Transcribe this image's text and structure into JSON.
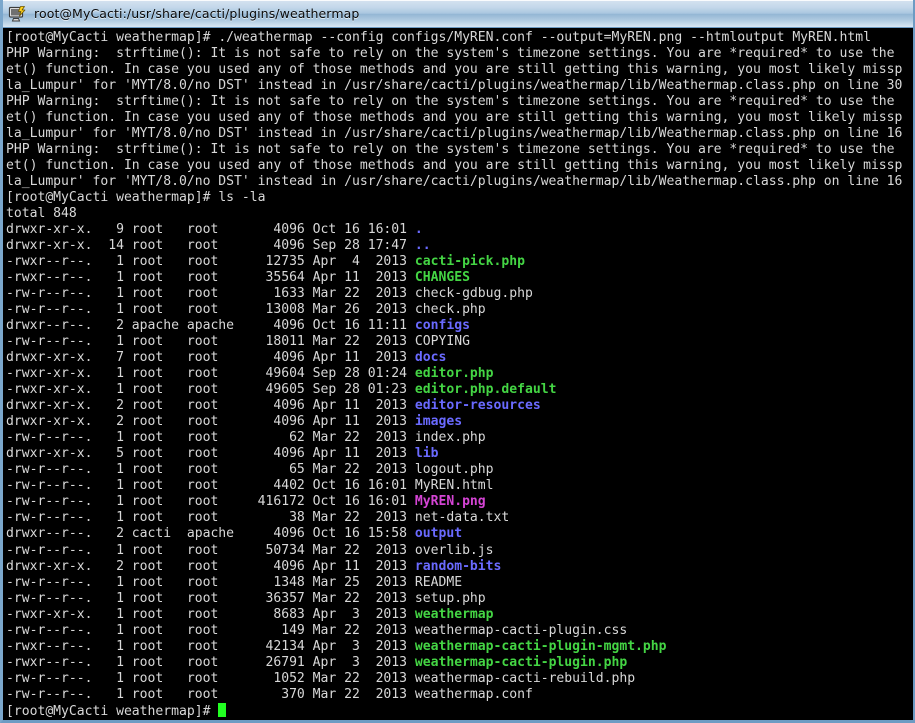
{
  "window": {
    "title": "root@MyCacti:/usr/share/cacti/plugins/weathermap",
    "icon": "putty-terminal-icon",
    "colors": {
      "titlebar_start": "#d5e3f0",
      "titlebar_end": "#d9e7f3",
      "border": "#6d9bc3",
      "terminal_background": "#000000",
      "terminal_foreground": "#d8d8d8",
      "dir_color": "#6a6aff",
      "exec_color": "#44d544",
      "image_color": "#d544d5",
      "cursor_color": "#22ff22"
    }
  },
  "terminal": {
    "prompt": "[root@MyCacti weathermap]#",
    "lines": [
      {
        "type": "command",
        "prompt": "[root@MyCacti weathermap]#",
        "command": " ./weathermap --config configs/MyREN.conf --output=MyREN.png --htmloutput MyREN.html"
      },
      {
        "type": "text",
        "text": "PHP Warning:  strftime(): It is not safe to rely on the system's timezone settings. You are *required* to use the "
      },
      {
        "type": "text",
        "text": "et() function. In case you used any of those methods and you are still getting this warning, you most likely missp"
      },
      {
        "type": "text",
        "text": "la_Lumpur' for 'MYT/8.0/no DST' instead in /usr/share/cacti/plugins/weathermap/lib/Weathermap.class.php on line 30"
      },
      {
        "type": "text",
        "text": "PHP Warning:  strftime(): It is not safe to rely on the system's timezone settings. You are *required* to use the "
      },
      {
        "type": "text",
        "text": "et() function. In case you used any of those methods and you are still getting this warning, you most likely missp"
      },
      {
        "type": "text",
        "text": "la_Lumpur' for 'MYT/8.0/no DST' instead in /usr/share/cacti/plugins/weathermap/lib/Weathermap.class.php on line 16"
      },
      {
        "type": "text",
        "text": "PHP Warning:  strftime(): It is not safe to rely on the system's timezone settings. You are *required* to use the "
      },
      {
        "type": "text",
        "text": "et() function. In case you used any of those methods and you are still getting this warning, you most likely missp"
      },
      {
        "type": "text",
        "text": "la_Lumpur' for 'MYT/8.0/no DST' instead in /usr/share/cacti/plugins/weathermap/lib/Weathermap.class.php on line 16"
      },
      {
        "type": "command",
        "prompt": "[root@MyCacti weathermap]#",
        "command": " ls -la"
      },
      {
        "type": "text",
        "text": "total 848"
      }
    ],
    "listing": {
      "total": "total 848",
      "command": "ls -la",
      "rows": [
        {
          "perms": "drwxr-xr-x.",
          "links": "9",
          "owner": "root",
          "group": "root",
          "size": "4096",
          "month": "Oct",
          "day": "16",
          "time": "16:01",
          "name": ".",
          "color": "dir"
        },
        {
          "perms": "drwxr-xr-x.",
          "links": "14",
          "owner": "root",
          "group": "root",
          "size": "4096",
          "month": "Sep",
          "day": "28",
          "time": "17:47",
          "name": "..",
          "color": "dir"
        },
        {
          "perms": "-rwxr--r--.",
          "links": "1",
          "owner": "root",
          "group": "root",
          "size": "12735",
          "month": "Apr",
          "day": "4",
          "time": "2013",
          "name": "cacti-pick.php",
          "color": "exec"
        },
        {
          "perms": "-rwxr--r--.",
          "links": "1",
          "owner": "root",
          "group": "root",
          "size": "35564",
          "month": "Apr",
          "day": "11",
          "time": "2013",
          "name": "CHANGES",
          "color": "exec"
        },
        {
          "perms": "-rw-r--r--.",
          "links": "1",
          "owner": "root",
          "group": "root",
          "size": "1633",
          "month": "Mar",
          "day": "22",
          "time": "2013",
          "name": "check-gdbug.php",
          "color": "default"
        },
        {
          "perms": "-rw-r--r--.",
          "links": "1",
          "owner": "root",
          "group": "root",
          "size": "13008",
          "month": "Mar",
          "day": "26",
          "time": "2013",
          "name": "check.php",
          "color": "default"
        },
        {
          "perms": "drwxr--r--.",
          "links": "2",
          "owner": "apache",
          "group": "apache",
          "size": "4096",
          "month": "Oct",
          "day": "16",
          "time": "11:11",
          "name": "configs",
          "color": "dir"
        },
        {
          "perms": "-rw-r--r--.",
          "links": "1",
          "owner": "root",
          "group": "root",
          "size": "18011",
          "month": "Mar",
          "day": "22",
          "time": "2013",
          "name": "COPYING",
          "color": "default"
        },
        {
          "perms": "drwxr-xr-x.",
          "links": "7",
          "owner": "root",
          "group": "root",
          "size": "4096",
          "month": "Apr",
          "day": "11",
          "time": "2013",
          "name": "docs",
          "color": "dir"
        },
        {
          "perms": "-rwxr-xr-x.",
          "links": "1",
          "owner": "root",
          "group": "root",
          "size": "49604",
          "month": "Sep",
          "day": "28",
          "time": "01:24",
          "name": "editor.php",
          "color": "exec"
        },
        {
          "perms": "-rwxr-xr-x.",
          "links": "1",
          "owner": "root",
          "group": "root",
          "size": "49605",
          "month": "Sep",
          "day": "28",
          "time": "01:23",
          "name": "editor.php.default",
          "color": "exec"
        },
        {
          "perms": "drwxr-xr-x.",
          "links": "2",
          "owner": "root",
          "group": "root",
          "size": "4096",
          "month": "Apr",
          "day": "11",
          "time": "2013",
          "name": "editor-resources",
          "color": "dir"
        },
        {
          "perms": "drwxr-xr-x.",
          "links": "2",
          "owner": "root",
          "group": "root",
          "size": "4096",
          "month": "Apr",
          "day": "11",
          "time": "2013",
          "name": "images",
          "color": "dir"
        },
        {
          "perms": "-rw-r--r--.",
          "links": "1",
          "owner": "root",
          "group": "root",
          "size": "62",
          "month": "Mar",
          "day": "22",
          "time": "2013",
          "name": "index.php",
          "color": "default"
        },
        {
          "perms": "drwxr-xr-x.",
          "links": "5",
          "owner": "root",
          "group": "root",
          "size": "4096",
          "month": "Apr",
          "day": "11",
          "time": "2013",
          "name": "lib",
          "color": "dir"
        },
        {
          "perms": "-rw-r--r--.",
          "links": "1",
          "owner": "root",
          "group": "root",
          "size": "65",
          "month": "Mar",
          "day": "22",
          "time": "2013",
          "name": "logout.php",
          "color": "default"
        },
        {
          "perms": "-rw-r--r--.",
          "links": "1",
          "owner": "root",
          "group": "root",
          "size": "4402",
          "month": "Oct",
          "day": "16",
          "time": "16:01",
          "name": "MyREN.html",
          "color": "default"
        },
        {
          "perms": "-rw-r--r--.",
          "links": "1",
          "owner": "root",
          "group": "root",
          "size": "416172",
          "month": "Oct",
          "day": "16",
          "time": "16:01",
          "name": "MyREN.png",
          "color": "image"
        },
        {
          "perms": "-rw-r--r--.",
          "links": "1",
          "owner": "root",
          "group": "root",
          "size": "38",
          "month": "Mar",
          "day": "22",
          "time": "2013",
          "name": "net-data.txt",
          "color": "default"
        },
        {
          "perms": "drwxr--r--.",
          "links": "2",
          "owner": "cacti",
          "group": "apache",
          "size": "4096",
          "month": "Oct",
          "day": "16",
          "time": "15:58",
          "name": "output",
          "color": "dir"
        },
        {
          "perms": "-rw-r--r--.",
          "links": "1",
          "owner": "root",
          "group": "root",
          "size": "50734",
          "month": "Mar",
          "day": "22",
          "time": "2013",
          "name": "overlib.js",
          "color": "default"
        },
        {
          "perms": "drwxr-xr-x.",
          "links": "2",
          "owner": "root",
          "group": "root",
          "size": "4096",
          "month": "Apr",
          "day": "11",
          "time": "2013",
          "name": "random-bits",
          "color": "dir"
        },
        {
          "perms": "-rw-r--r--.",
          "links": "1",
          "owner": "root",
          "group": "root",
          "size": "1348",
          "month": "Mar",
          "day": "25",
          "time": "2013",
          "name": "README",
          "color": "default"
        },
        {
          "perms": "-rw-r--r--.",
          "links": "1",
          "owner": "root",
          "group": "root",
          "size": "36357",
          "month": "Mar",
          "day": "22",
          "time": "2013",
          "name": "setup.php",
          "color": "default"
        },
        {
          "perms": "-rwxr-xr-x.",
          "links": "1",
          "owner": "root",
          "group": "root",
          "size": "8683",
          "month": "Apr",
          "day": "3",
          "time": "2013",
          "name": "weathermap",
          "color": "exec"
        },
        {
          "perms": "-rw-r--r--.",
          "links": "1",
          "owner": "root",
          "group": "root",
          "size": "149",
          "month": "Mar",
          "day": "22",
          "time": "2013",
          "name": "weathermap-cacti-plugin.css",
          "color": "default"
        },
        {
          "perms": "-rwxr--r--.",
          "links": "1",
          "owner": "root",
          "group": "root",
          "size": "42134",
          "month": "Apr",
          "day": "3",
          "time": "2013",
          "name": "weathermap-cacti-plugin-mgmt.php",
          "color": "exec"
        },
        {
          "perms": "-rwxr--r--.",
          "links": "1",
          "owner": "root",
          "group": "root",
          "size": "26791",
          "month": "Apr",
          "day": "3",
          "time": "2013",
          "name": "weathermap-cacti-plugin.php",
          "color": "exec"
        },
        {
          "perms": "-rw-r--r--.",
          "links": "1",
          "owner": "root",
          "group": "root",
          "size": "1052",
          "month": "Mar",
          "day": "22",
          "time": "2013",
          "name": "weathermap-cacti-rebuild.php",
          "color": "default"
        },
        {
          "perms": "-rw-r--r--.",
          "links": "1",
          "owner": "root",
          "group": "root",
          "size": "370",
          "month": "Mar",
          "day": "22",
          "time": "2013",
          "name": "weathermap.conf",
          "color": "default"
        }
      ]
    },
    "final_prompt": "[root@MyCacti weathermap]#"
  }
}
